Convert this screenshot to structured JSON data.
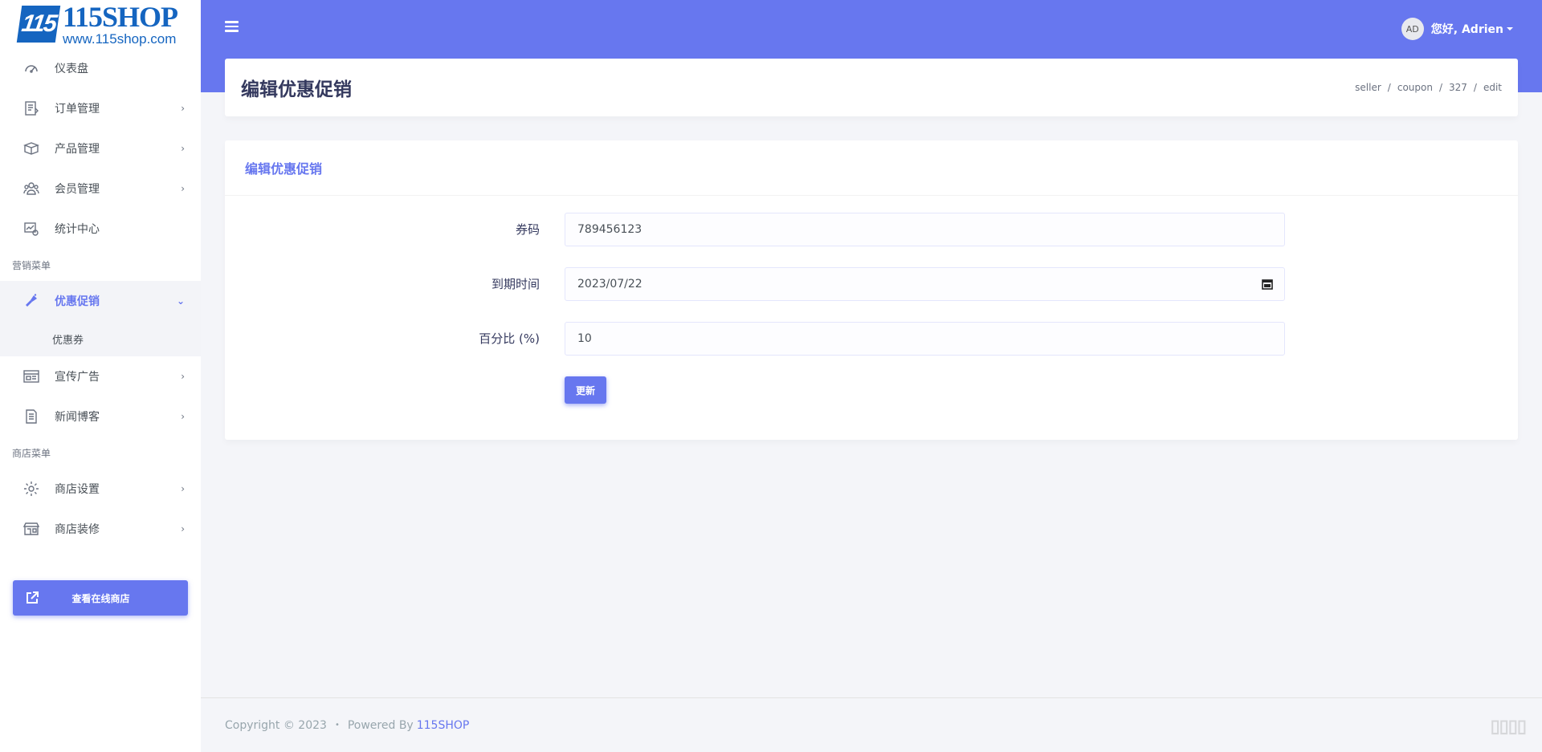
{
  "logo": {
    "mark": "115",
    "title": "115SHOP",
    "url": "www.115shop.com"
  },
  "header": {
    "avatar_initials": "AD",
    "greeting": "您好, Adrien"
  },
  "sidebar": {
    "items": [
      {
        "label": "仪表盘",
        "icon": "dashboard-icon"
      },
      {
        "label": "订单管理",
        "icon": "orders-icon"
      },
      {
        "label": "产品管理",
        "icon": "products-icon"
      },
      {
        "label": "会员管理",
        "icon": "members-icon"
      },
      {
        "label": "统计中心",
        "icon": "stats-icon"
      }
    ],
    "section_marketing": "营销菜单",
    "marketing_items": [
      {
        "label": "优惠促销",
        "icon": "promotion-icon",
        "active": true
      },
      {
        "label": "宣传广告",
        "icon": "ads-icon"
      },
      {
        "label": "新闻博客",
        "icon": "news-icon"
      }
    ],
    "submenu_coupon": "优惠券",
    "section_store": "商店菜单",
    "store_items": [
      {
        "label": "商店设置",
        "icon": "gear-icon"
      },
      {
        "label": "商店装修",
        "icon": "store-decor-icon"
      }
    ],
    "store_button": "查看在线商店"
  },
  "page": {
    "title": "编辑优惠促销",
    "breadcrumb": [
      "seller",
      "coupon",
      "327",
      "edit"
    ]
  },
  "form": {
    "card_title": "编辑优惠促销",
    "code_label": "券码",
    "code_value": "789456123",
    "expiry_label": "到期时间",
    "expiry_value": "2023/07/22",
    "percent_label": "百分比 (%)",
    "percent_value": "10",
    "submit_label": "更新"
  },
  "footer": {
    "copyright": "Copyright © 2023",
    "bullet": "•",
    "powered": "Powered By",
    "brand": "115SHOP"
  },
  "colors": {
    "primary": "#6777ef",
    "background": "#f4f5f9",
    "logo_blue": "#1565c0"
  }
}
